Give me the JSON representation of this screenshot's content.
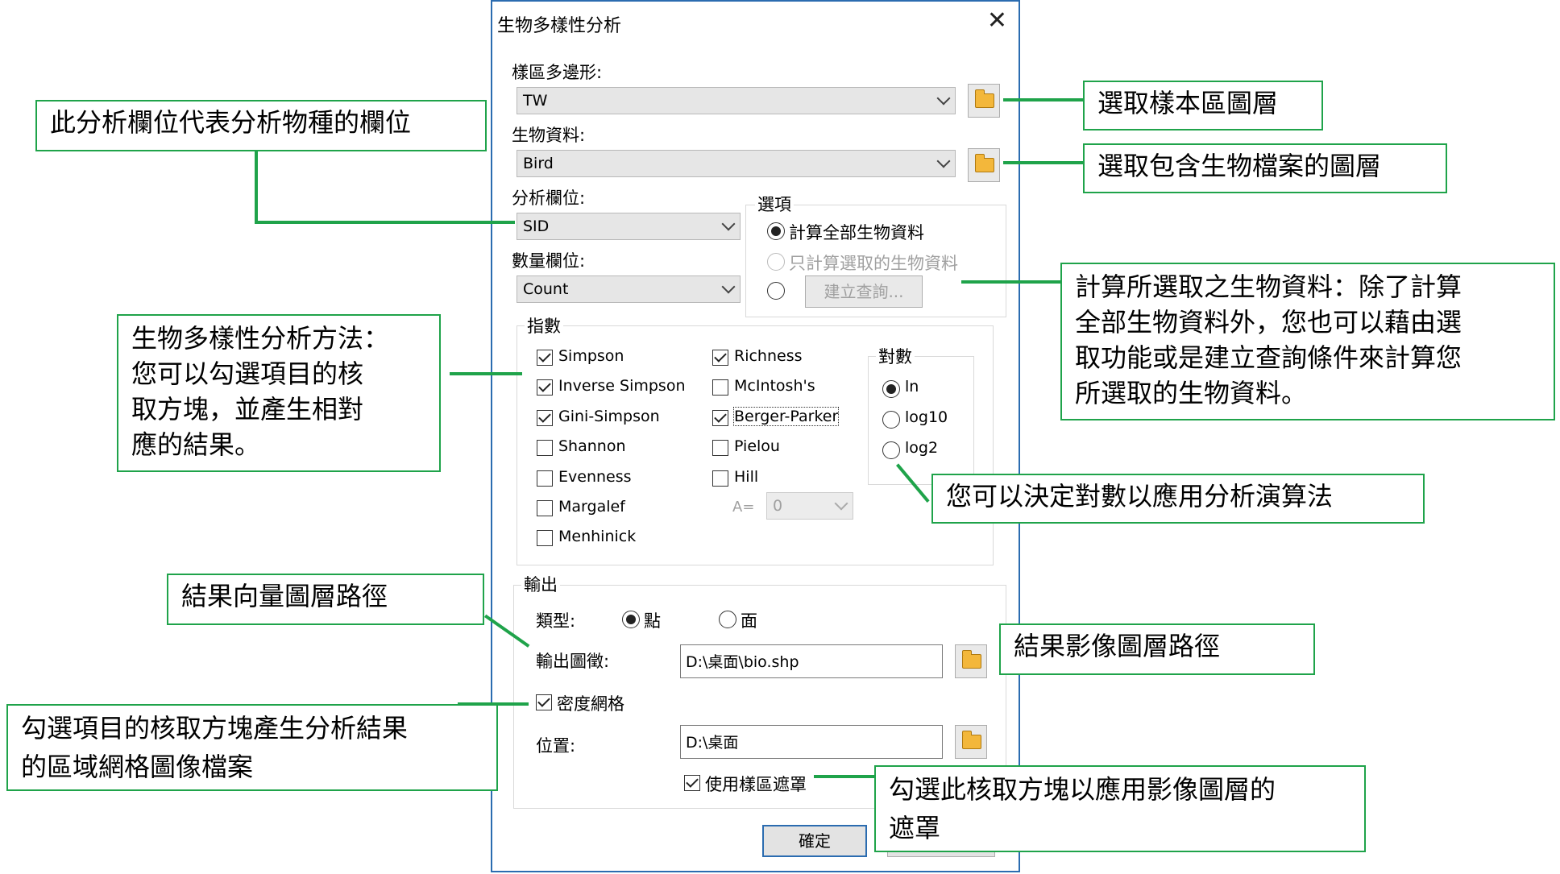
{
  "dialog": {
    "title": "生物多樣性分析",
    "close_glyph": "✕",
    "sample_polygon": {
      "label": "樣區多邊形:",
      "value": "TW"
    },
    "bio_data": {
      "label": "生物資料:",
      "value": "Bird"
    },
    "analysis_field": {
      "label": "分析欄位:",
      "value": "SID"
    },
    "count_field": {
      "label": "數量欄位:",
      "value": "Count"
    },
    "options": {
      "title": "選項",
      "all": "計算全部生物資料",
      "selected": "只計算選取的生物資料",
      "query_button": "建立查詢..."
    },
    "indices": {
      "title": "指數",
      "col1": [
        "Simpson",
        "Inverse Simpson",
        "Gini-Simpson",
        "Shannon",
        "Evenness",
        "Margalef",
        "Menhinick"
      ],
      "col2": [
        "Richness",
        "McIntosh's",
        "Berger-Parker",
        "Pielou",
        "Hill"
      ],
      "a_label": "A=",
      "a_value": "0"
    },
    "log": {
      "title": "對數",
      "ln": "ln",
      "log10": "log10",
      "log2": "log2"
    },
    "output": {
      "title": "輸出",
      "type_label": "類型:",
      "point": "點",
      "polygon": "面",
      "path_label": "輸出圖徵:",
      "path_value": "D:\\桌面\\bio.shp",
      "density_grid": "密度網格",
      "location_label": "位置:",
      "location_value": "D:\\桌面",
      "use_mask": "使用樣區遮罩"
    },
    "ok_button": "確定"
  },
  "callouts": {
    "select_sample_layer": "選取樣本區圖層",
    "select_bio_layer": "選取包含生物檔案的圖層",
    "analysis_field_desc": "此分析欄位代表分析物種的欄位",
    "calc_selected_desc": "計算所選取之生物資料：除了計算\n全部生物資料外，您也可以藉由選\n取功能或是建立查詢條件來計算您\n所選取的生物資料。",
    "method_desc": "生物多樣性分析方法：\n您可以勾選項目的核\n取方塊，並產生相對\n應的結果。",
    "log_desc": "您可以決定對數以應用分析演算法",
    "vector_path_desc": "結果向量圖層路徑",
    "raster_path_desc": "結果影像圖層路徑",
    "grid_desc": "勾選項目的核取方塊產生分析結果\n的區域網格圖像檔案",
    "mask_desc": "勾選此核取方塊以應用影像圖層的\n遮罩"
  }
}
